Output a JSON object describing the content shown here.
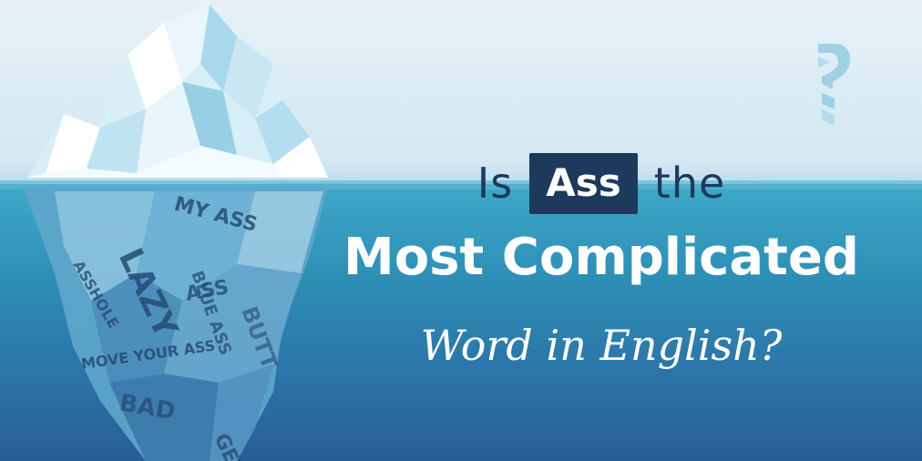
{
  "headline": {
    "line1_prefix": "Is",
    "line1_highlight": "Ass",
    "line1_suffix": "the",
    "line2": "Most Complicated",
    "line3": "Word in English?"
  },
  "iceberg_words": [
    "MY ASS",
    "BLUE ASS",
    "ASSHOLE",
    "LAZY",
    "ASS",
    "MOVE YOUR ASS",
    "BAD",
    "BUTT",
    "GET"
  ],
  "logo": {
    "icon": "question-mark-logo-icon"
  },
  "colors": {
    "sky": "#e6f1f7",
    "water_top": "#3fa9c9",
    "water_bottom": "#285e98",
    "highlight_bg": "#1d3a5c",
    "text_white": "#ffffff",
    "logo": "#9fd1e6"
  }
}
